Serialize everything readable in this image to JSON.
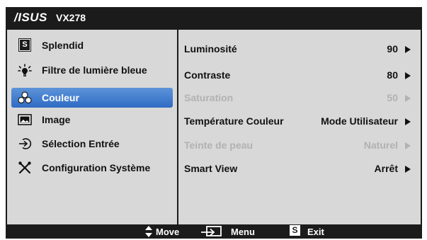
{
  "titlebar": {
    "brand": "/ISUS",
    "model": "VX278"
  },
  "sidebar": {
    "items": [
      {
        "label": "Splendid",
        "icon": "splendid-s-icon",
        "selected": false
      },
      {
        "label": "Filtre de lumière bleue",
        "icon": "light-bulb-icon",
        "selected": false
      },
      {
        "label": "Couleur",
        "icon": "color-palette-icon",
        "selected": true
      },
      {
        "label": "Image",
        "icon": "image-icon",
        "selected": false
      },
      {
        "label": "Sélection Entrée",
        "icon": "input-arrow-icon",
        "selected": false
      },
      {
        "label": "Configuration Système",
        "icon": "tools-icon",
        "selected": false
      }
    ]
  },
  "settings": {
    "rows": [
      {
        "label": "Luminosité",
        "value": "90",
        "enabled": true
      },
      {
        "label": "Contraste",
        "value": "80",
        "enabled": true
      },
      {
        "label": "Saturation",
        "value": "50",
        "enabled": false
      },
      {
        "label": "Température Couleur",
        "value": "Mode Utilisateur",
        "enabled": true
      },
      {
        "label": "Teinte de peau",
        "value": "Naturel",
        "enabled": false
      },
      {
        "label": "Smart View",
        "value": "Arrêt",
        "enabled": true
      }
    ]
  },
  "footer": {
    "move_label": "Move",
    "menu_label": "Menu",
    "exit_label": "Exit",
    "exit_icon_letter": "S"
  },
  "colors": {
    "background": "#1b1b1b",
    "panel": "#d8d8d8",
    "selected": "#3f7bcf",
    "disabled_text": "#b1b1b1"
  }
}
